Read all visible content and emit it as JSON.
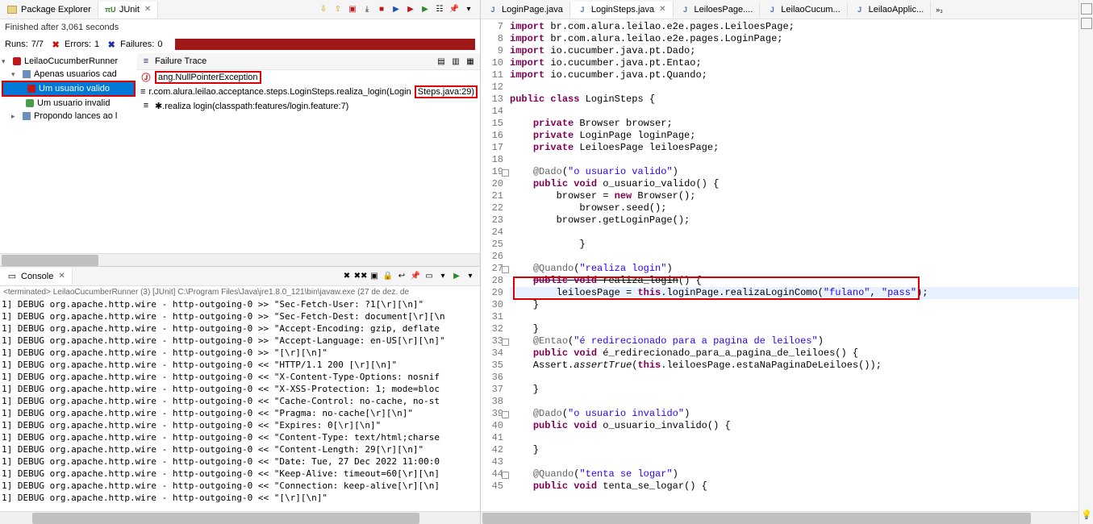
{
  "left_tabs": {
    "pkg_explorer": "Package Explorer",
    "junit": "JUnit"
  },
  "junit": {
    "finished": "Finished after 3,061 seconds",
    "runs_label": "Runs:",
    "runs_value": "7/7",
    "errors_label": "Errors:",
    "errors_value": "1",
    "failures_label": "Failures:",
    "failures_value": "0",
    "tree": {
      "root": "LeilaoCucumberRunner",
      "sc1": "Apenas usuarios cad",
      "leaf1": "Um usuario valido",
      "leaf2": "Um usuario invalid",
      "sc2": "Propondo lances ao l"
    },
    "failure_trace": {
      "title": "Failure Trace",
      "line1a": "ang.NullPointerException",
      "line2a": "r.com.alura.leilao.acceptance.steps.LoginSteps.realiza_login(Login",
      "line2b": "Steps.java:29)",
      "line3": "✱.realiza login(classpath:features/login.feature:7)"
    }
  },
  "console": {
    "tab": "Console",
    "info": "<terminated> LeilaoCucumberRunner (3) [JUnit] C:\\Program Files\\Java\\jre1.8.0_121\\bin\\javaw.exe (27 de dez. de",
    "lines": [
      "1] DEBUG org.apache.http.wire - http-outgoing-0 >> \"Sec-Fetch-User: ?1[\\r][\\n]\"",
      "1] DEBUG org.apache.http.wire - http-outgoing-0 >> \"Sec-Fetch-Dest: document[\\r][\\n",
      "1] DEBUG org.apache.http.wire - http-outgoing-0 >> \"Accept-Encoding: gzip, deflate",
      "1] DEBUG org.apache.http.wire - http-outgoing-0 >> \"Accept-Language: en-US[\\r][\\n]\"",
      "1] DEBUG org.apache.http.wire - http-outgoing-0 >> \"[\\r][\\n]\"",
      "1] DEBUG org.apache.http.wire - http-outgoing-0 << \"HTTP/1.1 200 [\\r][\\n]\"",
      "1] DEBUG org.apache.http.wire - http-outgoing-0 << \"X-Content-Type-Options: nosnif",
      "1] DEBUG org.apache.http.wire - http-outgoing-0 << \"X-XSS-Protection: 1; mode=bloc",
      "1] DEBUG org.apache.http.wire - http-outgoing-0 << \"Cache-Control: no-cache, no-st",
      "1] DEBUG org.apache.http.wire - http-outgoing-0 << \"Pragma: no-cache[\\r][\\n]\"",
      "1] DEBUG org.apache.http.wire - http-outgoing-0 << \"Expires: 0[\\r][\\n]\"",
      "1] DEBUG org.apache.http.wire - http-outgoing-0 << \"Content-Type: text/html;charse",
      "1] DEBUG org.apache.http.wire - http-outgoing-0 << \"Content-Length: 29[\\r][\\n]\"",
      "1] DEBUG org.apache.http.wire - http-outgoing-0 << \"Date: Tue, 27 Dec 2022 11:00:0",
      "1] DEBUG org.apache.http.wire - http-outgoing-0 << \"Keep-Alive: timeout=60[\\r][\\n]",
      "1] DEBUG org.apache.http.wire - http-outgoing-0 << \"Connection: keep-alive[\\r][\\n]",
      "1] DEBUG org.apache.http.wire - http-outgoing-0 << \"[\\r][\\n]\""
    ]
  },
  "editor_tabs": {
    "t1": "LoginPage.java",
    "t2": "LoginSteps.java",
    "t3": "LeiloesPage....",
    "t4": "LeilaoCucum...",
    "t5": "LeilaoApplic...",
    "more": "»₃"
  },
  "code": {
    "lines": [
      {
        "n": 7,
        "html": "<span class='kw'>import</span> br.com.alura.leilao.e2e.pages.LeiloesPage;"
      },
      {
        "n": 8,
        "html": "<span class='kw'>import</span> br.com.alura.leilao.e2e.pages.LoginPage;"
      },
      {
        "n": 9,
        "html": "<span class='kw'>import</span> io.cucumber.java.pt.Dado;"
      },
      {
        "n": 10,
        "html": "<span class='kw'>import</span> io.cucumber.java.pt.Entao;"
      },
      {
        "n": 11,
        "html": "<span class='kw'>import</span> io.cucumber.java.pt.Quando;"
      },
      {
        "n": 12,
        "html": ""
      },
      {
        "n": 13,
        "html": "<span class='kw'>public</span> <span class='kw'>class</span> LoginSteps {"
      },
      {
        "n": 14,
        "html": ""
      },
      {
        "n": 15,
        "html": "    <span class='kw'>private</span> Browser browser;"
      },
      {
        "n": 16,
        "html": "    <span class='kw'>private</span> LoginPage loginPage;"
      },
      {
        "n": 17,
        "html": "    <span class='kw'>private</span> LeiloesPage leiloesPage;"
      },
      {
        "n": 18,
        "html": ""
      },
      {
        "n": 19,
        "fold": true,
        "html": "    <span class='ann'>@Dado</span>(<span class='str'>\"o usuario valido\"</span>)"
      },
      {
        "n": 20,
        "html": "    <span class='kw'>public</span> <span class='kw'>void</span> o_usuario_valido() {"
      },
      {
        "n": 21,
        "html": "        browser = <span class='kw'>new</span> Browser();"
      },
      {
        "n": 22,
        "html": "            browser.seed();"
      },
      {
        "n": 23,
        "html": "        browser.getLoginPage();"
      },
      {
        "n": 24,
        "html": ""
      },
      {
        "n": 25,
        "html": "            }"
      },
      {
        "n": 26,
        "html": ""
      },
      {
        "n": 27,
        "fold": true,
        "html": "    <span class='ann'>@Quando</span>(<span class='str'>\"realiza login\"</span>)"
      },
      {
        "n": 28,
        "html": "    <span class='kw strike'>public</span><span class='strike'> </span><span class='kw strike'>void</span><span class='strike'> realiza_login</span>() {"
      },
      {
        "n": 29,
        "current": true,
        "html": "        leiloesPage = <span class='kw'>this</span>.loginPage.realizaLoginComo(<span class='str'>\"fulano\"</span>, <span class='str'>\"pass\"</span>);"
      },
      {
        "n": 30,
        "html": "    }"
      },
      {
        "n": 31,
        "html": ""
      },
      {
        "n": 32,
        "html": "    }"
      },
      {
        "n": 33,
        "fold": true,
        "html": "    <span class='ann'>@Entao</span>(<span class='str'>\"é redirecionado para a pagina de leiloes\"</span>)"
      },
      {
        "n": 34,
        "html": "    <span class='kw'>public</span> <span class='kw'>void</span> é_redirecionado_para_a_pagina_de_leiloes() {"
      },
      {
        "n": 35,
        "html": "    Assert.<span class='method-italic'>assertTrue</span>(<span class='kw'>this</span>.leiloesPage.estaNaPaginaDeLeiloes());"
      },
      {
        "n": 36,
        "html": ""
      },
      {
        "n": 37,
        "html": "    }"
      },
      {
        "n": 38,
        "html": ""
      },
      {
        "n": 39,
        "fold": true,
        "html": "    <span class='ann'>@Dado</span>(<span class='str'>\"o usuario invalido\"</span>)"
      },
      {
        "n": 40,
        "html": "    <span class='kw'>public</span> <span class='kw'>void</span> o_usuario_invalido() {"
      },
      {
        "n": 41,
        "html": ""
      },
      {
        "n": 42,
        "html": "    }"
      },
      {
        "n": 43,
        "html": ""
      },
      {
        "n": 44,
        "fold": true,
        "html": "    <span class='ann'>@Quando</span>(<span class='str'>\"tenta se logar\"</span>)"
      },
      {
        "n": 45,
        "html": "    <span class='kw'>public</span> <span class='kw'>void</span> tenta_se_logar() {"
      }
    ]
  }
}
